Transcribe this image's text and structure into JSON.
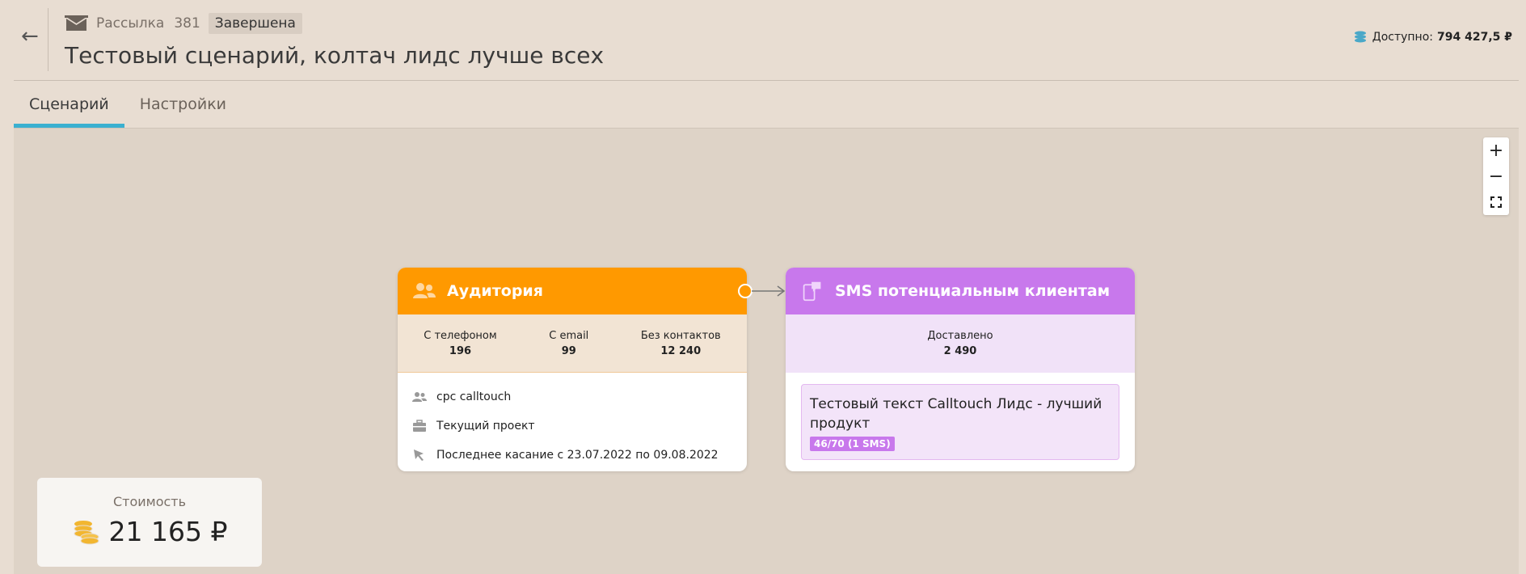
{
  "header": {
    "back_symbol": "←",
    "breadcrumb_label": "Рассылка",
    "breadcrumb_id": "381",
    "status": "Завершена",
    "title": "Тестовый сценарий, колтач лидс лучше всех",
    "balance_label": "Доступно:",
    "balance_value": "794 427,5 ₽"
  },
  "tabs": [
    {
      "label": "Сценарий",
      "active": true
    },
    {
      "label": "Настройки",
      "active": false
    }
  ],
  "zoom": {
    "in": "+",
    "out": "−",
    "fit_icon": "fullscreen-icon"
  },
  "audience_card": {
    "title": "Аудитория",
    "stats": [
      {
        "label": "С телефоном",
        "value": "196"
      },
      {
        "label": "С email",
        "value": "99"
      },
      {
        "label": "Без контактов",
        "value": "12 240"
      }
    ],
    "rows": [
      {
        "icon": "users-icon",
        "text": "cpc calltouch"
      },
      {
        "icon": "briefcase-icon",
        "text": "Текущий проект"
      },
      {
        "icon": "cursor-icon",
        "text": "Последнее касание с 23.07.2022 по 09.08.2022"
      }
    ]
  },
  "sms_card": {
    "title": "SMS потенциальным клиентам",
    "stat_label": "Доставлено",
    "stat_value": "2 490",
    "message": "Тестовый текст Calltouch Лидс - лучший продукт",
    "counter": "46/70 (1 SMS)"
  },
  "cost": {
    "label": "Стоимость",
    "value": "21 165 ₽"
  },
  "colors": {
    "audience": "#ff9900",
    "sms": "#c878ec",
    "tab_accent": "#3ab0d0",
    "coins": "#f2b630"
  }
}
